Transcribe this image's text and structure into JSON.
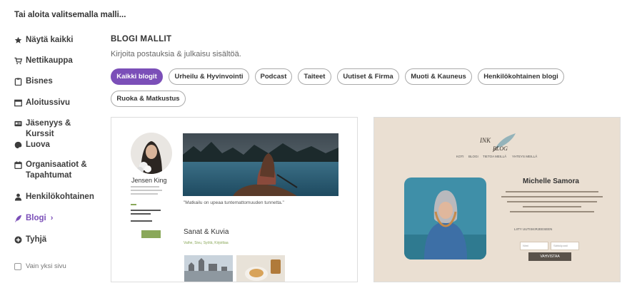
{
  "heading": "Tai aloita valitsemalla malli...",
  "sidebar": {
    "items": [
      {
        "label": "Näytä kaikki",
        "icon": "star-icon"
      },
      {
        "label": "Nettikauppa",
        "icon": "cart-icon"
      },
      {
        "label": "Bisnes",
        "icon": "clipboard-icon"
      },
      {
        "label": "Aloitussivu",
        "icon": "window-icon"
      },
      {
        "label": "Jäsenyys & Kurssit",
        "icon": "id-card-icon"
      },
      {
        "label": "Luova",
        "icon": "palette-icon"
      },
      {
        "label": "Organisaatiot & Tapahtumat",
        "icon": "calendar-icon"
      },
      {
        "label": "Henkilökohtainen",
        "icon": "person-icon"
      },
      {
        "label": "Blogi",
        "icon": "feather-icon",
        "active": true
      },
      {
        "label": "Tyhjä",
        "icon": "plus-circle-icon"
      }
    ],
    "single_page_label": "Vain yksi sivu"
  },
  "main": {
    "title": "BLOGI MALLIT",
    "subtitle": "Kirjoita postauksia & julkaisu sisältöä.",
    "filters": [
      {
        "label": "Kaikki blogit",
        "active": true
      },
      {
        "label": "Urheilu & Hyvinvointi"
      },
      {
        "label": "Podcast"
      },
      {
        "label": "Taiteet"
      },
      {
        "label": "Uutiset & Firma"
      },
      {
        "label": "Muoti & Kauneus"
      },
      {
        "label": "Henkilökohtainen blogi"
      },
      {
        "label": "Ruoka & Matkustus"
      }
    ]
  },
  "template1": {
    "author_name": "Jensen King",
    "quote": "\"Matkailu on upeaa tuntemattomuuden tunnetta.\"",
    "section_title": "Sanat & Kuvia",
    "section_tags": "Vaihe, Sivu, Syötä, Kirjoittaa"
  },
  "template2": {
    "logo_line1": "INK",
    "logo_line2": "BLOG",
    "nav": [
      "KOTI",
      "BLOGI",
      "TIETOA MEILLÄ",
      "YHTEYS MEILLÄ"
    ],
    "author_name": "Michelle Samora",
    "subscribe_label": "LIITY UUTISKIRJEESEEN",
    "input1_placeholder": "Nimi",
    "input2_placeholder": "Sähköposti",
    "button_label": "VAHVISTAA"
  },
  "colors": {
    "accent": "#7b4fb8",
    "card2_bg": "#eadfd2",
    "green": "#8aa85a"
  }
}
